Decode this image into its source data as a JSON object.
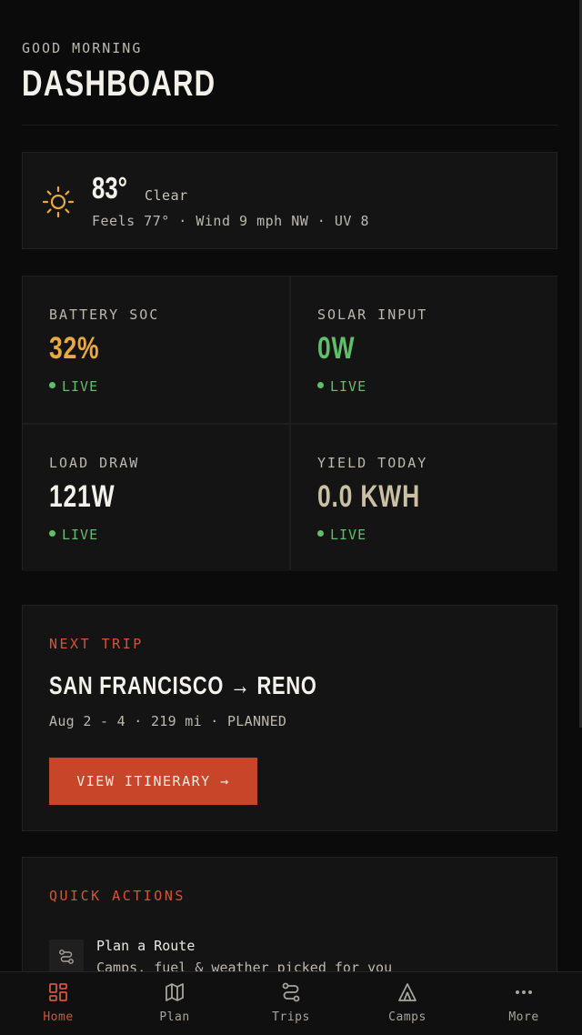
{
  "header": {
    "greeting": "GOOD MORNING",
    "title": "DASHBOARD"
  },
  "weather": {
    "icon": "sun-icon",
    "temperature": "83°",
    "condition": "Clear",
    "details": "Feels 77° · Wind 9 mph NW · UV 8",
    "icon_color": "#e9a93c"
  },
  "stats": [
    {
      "label": "BATTERY SOC",
      "value": "32%",
      "status": "LIVE",
      "color": "#e9a93c"
    },
    {
      "label": "SOLAR INPUT",
      "value": "0W",
      "status": "LIVE",
      "color": "#5fbf6a"
    },
    {
      "label": "LOAD DRAW",
      "value": "121W",
      "status": "LIVE",
      "color": "#f4f1ea"
    },
    {
      "label": "YIELD TODAY",
      "value": "0.0 KWH",
      "status": "LIVE",
      "color": "#cbbfa4"
    }
  ],
  "next_trip": {
    "section_label": "NEXT TRIP",
    "route": "SAN FRANCISCO → RENO",
    "meta": "Aug 2 - 4 · 219 mi · PLANNED",
    "button_label": "VIEW ITINERARY →"
  },
  "quick_actions": {
    "section_label": "QUICK ACTIONS",
    "items": [
      {
        "title": "Plan a Route",
        "subtitle": "Camps, fuel & weather picked for you",
        "icon": "route-icon"
      }
    ]
  },
  "tabbar": {
    "items": [
      {
        "label": "Home",
        "icon": "home-grid-icon",
        "active": true
      },
      {
        "label": "Plan",
        "icon": "map-icon",
        "active": false
      },
      {
        "label": "Trips",
        "icon": "route-icon",
        "active": false
      },
      {
        "label": "Camps",
        "icon": "tent-icon",
        "active": false
      },
      {
        "label": "More",
        "icon": "more-dots-icon",
        "active": false
      }
    ]
  },
  "colors": {
    "accent": "#c7462a",
    "live": "#5fbf6a",
    "background": "#0b0b0b",
    "card": "#141414"
  }
}
